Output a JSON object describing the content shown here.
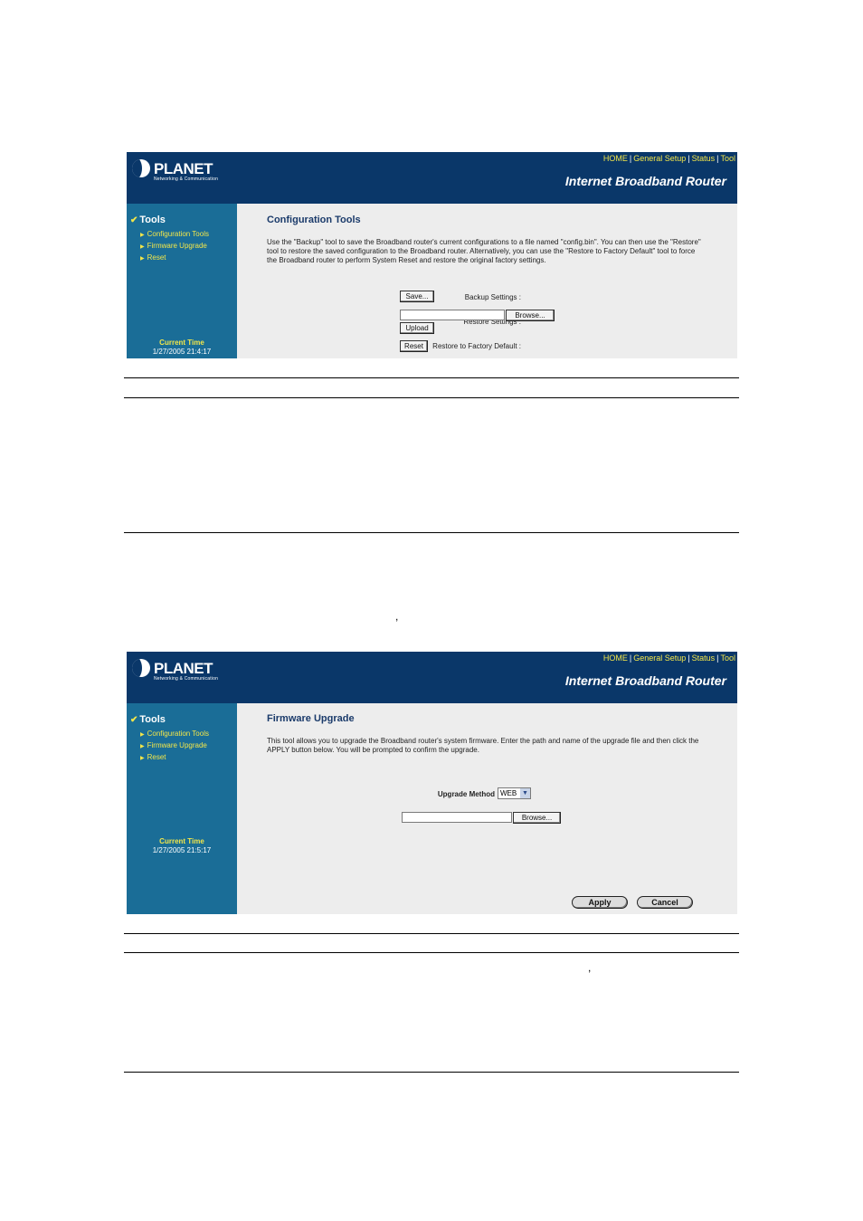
{
  "header": {
    "logo_text": "PLANET",
    "tagline": "Networking & Communication",
    "links": [
      "HOME",
      "General Setup",
      "Status",
      "Tool"
    ],
    "separator": "|",
    "product": "Internet Broadband Router"
  },
  "sidebar": {
    "title": "Tools",
    "items": [
      "Configuration Tools",
      "Firmware Upgrade",
      "Reset"
    ],
    "current_time_label": "Current Time"
  },
  "screen1": {
    "current_time": "1/27/2005 21:4:17",
    "title": "Configuration Tools",
    "description": "Use the \"Backup\" tool to save the Broadband router's current configurations to a file named \"config.bin\". You can then use the \"Restore\" tool to restore the saved configuration to the Broadband router. Alternatively, you can use the \"Restore to Factory Default\" tool to force the Broadband router to perform System Reset and restore the original factory settings.",
    "backup_label": "Backup Settings :",
    "save_button": "Save...",
    "restore_label": "Restore Settings :",
    "browse_button": "Browse...",
    "upload_button": "Upload",
    "factory_label": "Restore to Factory Default :",
    "reset_button": "Reset"
  },
  "screen2": {
    "current_time": "1/27/2005 21:5:17",
    "title": "Firmware Upgrade",
    "description": "This tool allows you to upgrade the Broadband router's system firmware. Enter the path and name of the upgrade file and then click the APPLY button below. You will be prompted to confirm the upgrade.",
    "method_label": "Upgrade Method",
    "method_value": "WEB",
    "browse_button": "Browse...",
    "apply_button": "Apply",
    "cancel_button": "Cancel"
  },
  "stray_marks": [
    ",",
    ","
  ],
  "colors": {
    "header_bg": "#0a3769",
    "sidebar_bg": "#1a6d97",
    "link_yellow": "#f2e64a",
    "content_bg": "#ededed"
  }
}
